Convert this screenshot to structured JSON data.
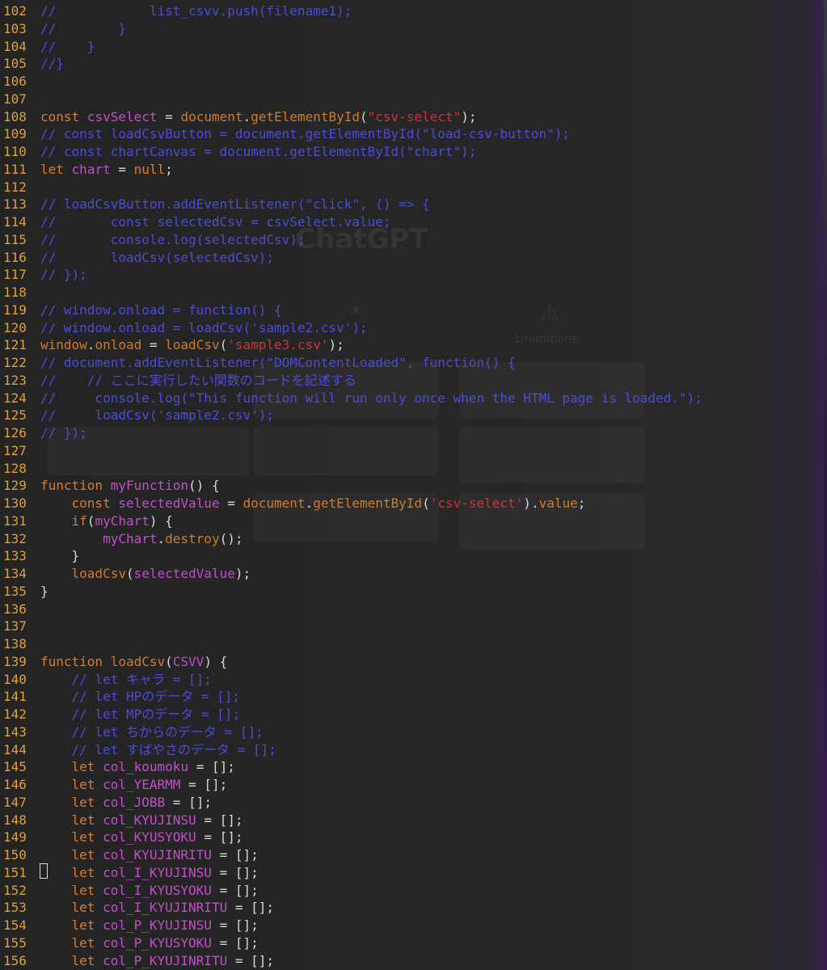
{
  "code_lines": [
    {
      "n": "102",
      "t": "//            list_csvv.push(filename1);"
    },
    {
      "n": "103",
      "t": "//        }"
    },
    {
      "n": "104",
      "t": "//    }"
    },
    {
      "n": "105",
      "t": "//}"
    },
    {
      "n": "106",
      "t": ""
    },
    {
      "n": "107",
      "t": ""
    },
    {
      "n": "108",
      "t": "const csvSelect = document.getElementById(\"csv-select\");"
    },
    {
      "n": "109",
      "t": "// const loadCsvButton = document.getElementById(\"load-csv-button\");"
    },
    {
      "n": "110",
      "t": "// const chartCanvas = document.getElementById(\"chart\");"
    },
    {
      "n": "111",
      "t": "let chart = null;"
    },
    {
      "n": "112",
      "t": ""
    },
    {
      "n": "113",
      "t": "// loadCsvButton.addEventListener(\"click\", () => {"
    },
    {
      "n": "114",
      "t": "//       const selectedCsv = csvSelect.value;"
    },
    {
      "n": "115",
      "t": "//       console.log(selectedCsv);"
    },
    {
      "n": "116",
      "t": "//       loadCsv(selectedCsv);"
    },
    {
      "n": "117",
      "t": "// });"
    },
    {
      "n": "118",
      "t": ""
    },
    {
      "n": "119",
      "t": "// window.onload = function() {"
    },
    {
      "n": "120",
      "t": "// window.onload = loadCsv('sample2.csv');"
    },
    {
      "n": "121",
      "t": "window.onload = loadCsv('sample3.csv');"
    },
    {
      "n": "122",
      "t": "// document.addEventListener(\"DOMContentLoaded\", function() {"
    },
    {
      "n": "123",
      "t": "//    // ここに実行したい関数のコードを記述する"
    },
    {
      "n": "124",
      "t": "//     console.log(\"This function will run only once when the HTML page is loaded.\");"
    },
    {
      "n": "125",
      "t": "//     loadCsv('sample2.csv');"
    },
    {
      "n": "126",
      "t": "// });"
    },
    {
      "n": "127",
      "t": ""
    },
    {
      "n": "128",
      "t": ""
    },
    {
      "n": "129",
      "t": "function myFunction() {"
    },
    {
      "n": "130",
      "t": "    const selectedValue = document.getElementById('csv-select').value;"
    },
    {
      "n": "131",
      "t": "    if(myChart) {"
    },
    {
      "n": "132",
      "t": "        myChart.destroy();"
    },
    {
      "n": "133",
      "t": "    }"
    },
    {
      "n": "134",
      "t": "    loadCsv(selectedValue);"
    },
    {
      "n": "135",
      "t": "}"
    },
    {
      "n": "136",
      "t": ""
    },
    {
      "n": "137",
      "t": ""
    },
    {
      "n": "138",
      "t": ""
    },
    {
      "n": "139",
      "t": "function loadCsv(CSVV) {"
    },
    {
      "n": "140",
      "t": "    // let キャラ = [];"
    },
    {
      "n": "141",
      "t": "    // let HPのデータ = [];"
    },
    {
      "n": "142",
      "t": "    // let MPのデータ = [];"
    },
    {
      "n": "143",
      "t": "    // let ちからのデータ = [];"
    },
    {
      "n": "144",
      "t": "    // let すばやさのデータ = [];"
    },
    {
      "n": "145",
      "t": "    let col_koumoku = [];"
    },
    {
      "n": "146",
      "t": "    let col_YEARMM = [];"
    },
    {
      "n": "147",
      "t": "    let col_JOBB = [];"
    },
    {
      "n": "148",
      "t": "    let col_KYUJINSU = [];"
    },
    {
      "n": "149",
      "t": "    let col_KYUSYOKU = [];"
    },
    {
      "n": "150",
      "t": "    let col_KYUJINRITU = [];"
    },
    {
      "n": "151",
      "t": "    let col_I_KYUJINSU = [];"
    },
    {
      "n": "152",
      "t": "    let col_I_KYUSYOKU = [];"
    },
    {
      "n": "153",
      "t": "    let col_I_KYUJINRITU = [];"
    },
    {
      "n": "154",
      "t": "    let col_P_KYUJINSU = [];"
    },
    {
      "n": "155",
      "t": "    let col_P_KYUSYOKU = [];"
    },
    {
      "n": "156",
      "t": "    let col_P_KYUJINRITU = [];"
    }
  ],
  "background_ghost": {
    "title": "ChatGPT",
    "limitations": "Limitations"
  },
  "colors": {
    "line_number": "#e0a035",
    "comment": "#4b4bd8",
    "keyword": "#e07a2a",
    "variable": "#c050c8",
    "string": "#d0303a"
  }
}
